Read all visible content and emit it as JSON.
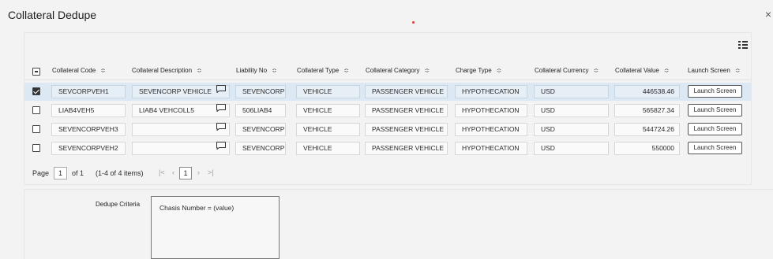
{
  "dialog": {
    "title": "Collateral Dedupe",
    "close_symbol": "×"
  },
  "grid": {
    "headers": {
      "collateral_code": "Collateral Code",
      "collateral_description": "Collateral Description",
      "liability_no": "Liability No",
      "collateral_type": "Collateral Type",
      "collateral_category": "Collateral Category",
      "charge_type": "Charge Type",
      "collateral_currency": "Collateral Currency",
      "collateral_value": "Collateral Value",
      "launch_screen": "Launch Screen"
    },
    "sort_symbol": "≎",
    "rows": [
      {
        "selected": true,
        "code": "SEVCORPVEH1",
        "description": "SEVENCORP VEHICLE",
        "liability": "SEVENCORP",
        "type": "VEHICLE",
        "category": "PASSENGER VEHICLE",
        "charge": "HYPOTHECATION",
        "currency": "USD",
        "value": "446538.46",
        "button": "Launch Screen"
      },
      {
        "selected": false,
        "code": "LIAB4VEH5",
        "description": "LIAB4 VEHCOLL5",
        "liability": "506LIAB4",
        "type": "VEHICLE",
        "category": "PASSENGER VEHICLE",
        "charge": "HYPOTHECATION",
        "currency": "USD",
        "value": "565827.34",
        "button": "Launch Screen"
      },
      {
        "selected": false,
        "code": "SEVENCORPVEH3",
        "description": "",
        "liability": "SEVENCORP",
        "type": "VEHICLE",
        "category": "PASSENGER VEHICLE",
        "charge": "HYPOTHECATION",
        "currency": "USD",
        "value": "544724.26",
        "button": "Launch Screen"
      },
      {
        "selected": false,
        "code": "SEVENCORPVEH2",
        "description": "",
        "liability": "SEVENCORP",
        "type": "VEHICLE",
        "category": "PASSENGER VEHICLE",
        "charge": "HYPOTHECATION",
        "currency": "USD",
        "value": "550000",
        "button": "Launch Screen"
      }
    ]
  },
  "pager": {
    "page_label": "Page",
    "page_value": "1",
    "of_label": "of 1",
    "items_label": "(1-4 of 4 items)",
    "first": "|<",
    "prev": "‹",
    "current": "1",
    "next": "›",
    "last": ">|"
  },
  "criteria": {
    "label": "Dedupe Criteria",
    "value": "Chasis Number = (value)"
  },
  "colors": {
    "selected_row": "#dce8f4",
    "accent_dot": "#e53935"
  }
}
